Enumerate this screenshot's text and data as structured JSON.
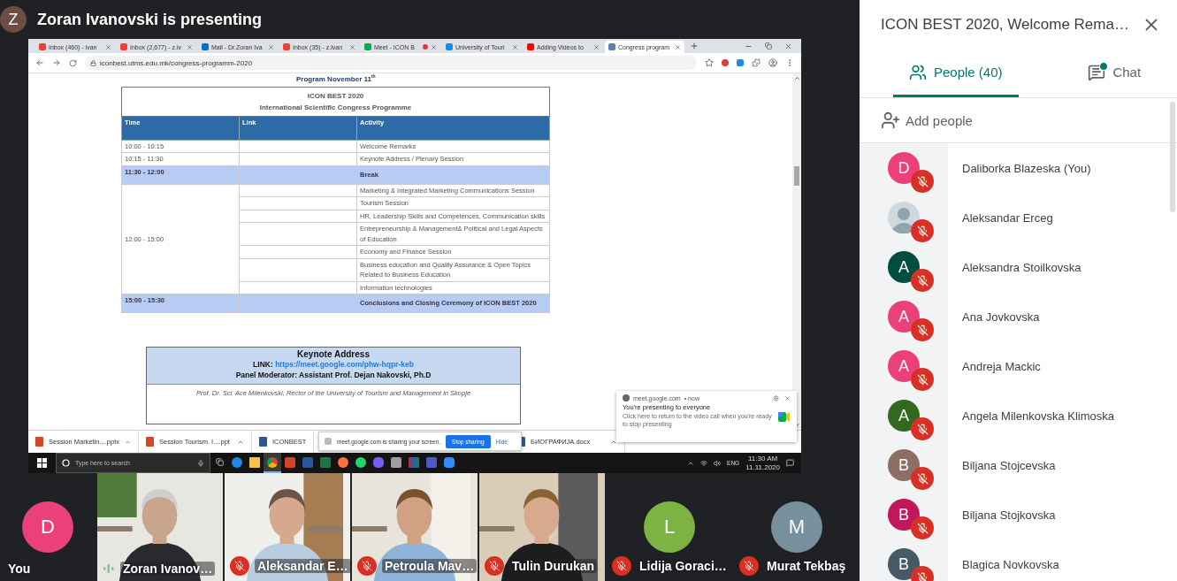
{
  "presenter": {
    "initial": "Z",
    "color": "#6d4c41",
    "label": "Zoran Ivanovski is presenting"
  },
  "browser": {
    "tabs": [
      {
        "title": "Inbox (460) - ivan",
        "kind": "gmail",
        "selected": false,
        "recording": false
      },
      {
        "title": "Inbox (2,677) - z.iv",
        "kind": "gmail",
        "selected": false,
        "recording": false
      },
      {
        "title": "Mail - Dr.Zoran Iva",
        "kind": "outlook",
        "selected": false,
        "recording": false
      },
      {
        "title": "Inbox (35) - z.ivan",
        "kind": "gmail",
        "selected": false,
        "recording": false
      },
      {
        "title": "Meet - ICON B",
        "kind": "meet",
        "selected": false,
        "recording": true
      },
      {
        "title": "University of Touri",
        "kind": "classroom",
        "selected": false,
        "recording": false
      },
      {
        "title": "Adding Videos to",
        "kind": "youtube",
        "selected": false,
        "recording": false
      },
      {
        "title": "Congress program",
        "kind": "site",
        "selected": true,
        "recording": false
      }
    ],
    "url": "iconbest.utms.edu.mk/congress-programm-2020",
    "page": {
      "heading": "Program November 11$^{th}$",
      "table": {
        "title": "ICON BEST 2020",
        "subtitle": "International Scientific Congress Programme",
        "columns": [
          "Time",
          "Link",
          "Activity"
        ],
        "groups": [
          {
            "time": "10:00 - 10:15",
            "highlight": false,
            "activities": [
              "Welcome Remarks"
            ]
          },
          {
            "time": "10:15 - 11:30",
            "highlight": false,
            "activities": [
              "Keynote Address / Plenary Session"
            ]
          },
          {
            "time": "11:30 - 12:00",
            "highlight": true,
            "activities": [
              "Break"
            ]
          },
          {
            "time": "12:00 - 15:00",
            "highlight": false,
            "activities": [
              "Marketing & Integrated Marketing Communications Session",
              "Tourism Session",
              "HR, Leadership Skills and Competences, Communication skills",
              "Entrepreneurship & Management& Political and Legal Aspects of Education",
              "Economy and Finance Session",
              "Business education and Quality Assurance & Open Topics Related to Business Education",
              "Information technologies"
            ]
          },
          {
            "time": "15:00 - 15:30",
            "highlight": true,
            "activities": [
              "Conclusions and Closing Ceremony of ICON BEST 2020"
            ]
          }
        ]
      },
      "keynote": {
        "title": "Keynote Address",
        "link_label": "LINK:",
        "link": "https://meet.google.com/phw-hqpr-keb",
        "moderator": "Panel Moderator: Assistant Prof. Dejan Nakovski, Ph.D",
        "speaker": "Prof. Dr. Sci. Ace Milenkovski, Rector of the University of Tourism and Management in Skopje"
      }
    }
  },
  "downloads": [
    {
      "name": "Session Marketin....pptx",
      "kind": "pptx"
    },
    {
      "name": "Session Tourism. I....ppt",
      "kind": "ppt"
    },
    {
      "name": "ICONBEST",
      "kind": "doc"
    },
    {
      "name": "БИОГРАФИЈА.docx",
      "kind": "doc"
    }
  ],
  "share_banner": {
    "message": "meet.google.com is sharing your screen.",
    "stop": "Stop sharing",
    "hide": "Hide"
  },
  "notification": {
    "source": "meet.google.com",
    "time": "• now",
    "title": "You're presenting to everyone",
    "body": "Click here to return to the video call when you're ready to stop presenting"
  },
  "taskbar": {
    "search_placeholder": "Type here to search",
    "apps": [
      {
        "kind": "edge",
        "selected": false
      },
      {
        "kind": "explorer",
        "selected": false
      },
      {
        "kind": "chrome",
        "selected": true
      },
      {
        "kind": "powerpoint",
        "selected": false
      },
      {
        "kind": "word",
        "selected": false
      },
      {
        "kind": "excel",
        "selected": false
      },
      {
        "kind": "firefox",
        "selected": false
      },
      {
        "kind": "whatsapp",
        "selected": false
      },
      {
        "kind": "viber",
        "selected": false
      },
      {
        "kind": "app",
        "selected": false
      },
      {
        "kind": "winrar",
        "selected": false
      },
      {
        "kind": "teams",
        "selected": false
      },
      {
        "kind": "zoom",
        "selected": false
      }
    ],
    "language": "ENG",
    "time": "11:30 AM",
    "date": "11.11.2020"
  },
  "tiles": [
    {
      "name": "You",
      "kind": "avatar",
      "initial": "D",
      "color": "#ec407a",
      "muted": false,
      "speaking": false
    },
    {
      "name": "Zoran Ivanov…",
      "kind": "video",
      "muted": false,
      "speaking": true
    },
    {
      "name": "Aleksandar E…",
      "kind": "video",
      "muted": true,
      "speaking": false
    },
    {
      "name": "Petroula Mav…",
      "kind": "video",
      "muted": true,
      "speaking": false
    },
    {
      "name": "Tulin Durukan",
      "kind": "video",
      "muted": true,
      "speaking": false
    },
    {
      "name": "Lidija Goraci…",
      "kind": "avatar",
      "initial": "L",
      "color": "#7cb342",
      "muted": true,
      "speaking": false
    },
    {
      "name": "Murat Tekbaş",
      "kind": "avatar",
      "initial": "M",
      "color": "#78909c",
      "muted": true,
      "speaking": false
    }
  ],
  "panel": {
    "title": "ICON BEST 2020, Welcome Rema…",
    "tabs": [
      {
        "label": "People (40)",
        "kind": "people",
        "selected": true,
        "unread": false
      },
      {
        "label": "Chat",
        "kind": "chat",
        "selected": false,
        "unread": true
      }
    ],
    "add_people": "Add people",
    "people": [
      {
        "name": "Daliborka Blazeska (You)",
        "kind": "letter",
        "initial": "D",
        "color": "#ec407a",
        "muted": true
      },
      {
        "name": "Aleksandar Erceg",
        "muted": true
      },
      {
        "name": "Aleksandra Stoilkovska",
        "kind": "letter",
        "initial": "A",
        "color": "#004d40",
        "muted": true
      },
      {
        "name": "Ana Jovkovska",
        "kind": "letter",
        "initial": "A",
        "color": "#ec407a",
        "muted": true
      },
      {
        "name": "Andreja Mackic",
        "kind": "letter",
        "initial": "A",
        "color": "#ec407a",
        "muted": true
      },
      {
        "name": "Angela Milenkovska Klimoska",
        "kind": "letter",
        "initial": "A",
        "color": "#33691e",
        "muted": true
      },
      {
        "name": "Biljana Stojcevska",
        "kind": "letter",
        "initial": "B",
        "color": "#8d6e63",
        "muted": true
      },
      {
        "name": "Biljana Stojkovska",
        "kind": "letter",
        "initial": "B",
        "color": "#c2185b",
        "muted": true
      },
      {
        "name": "Blagica Novkovska",
        "kind": "letter",
        "initial": "B",
        "color": "#455a64",
        "muted": true
      }
    ]
  }
}
